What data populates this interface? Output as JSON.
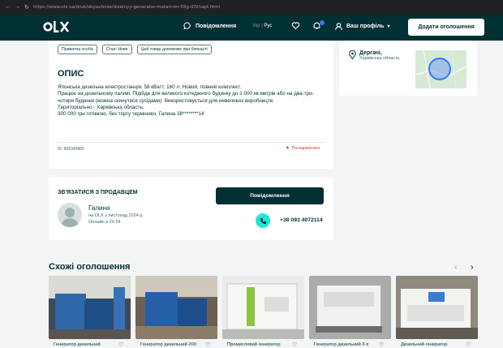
{
  "browser": {
    "url": "https://www.olx.ua/d/uk/obyavlenie/dizelnyy-generator-matari-mr-55g-IDV/uqd.html"
  },
  "header": {
    "messages_label": "Повідомлення",
    "lang_ukr": "Укр",
    "lang_sep": "|",
    "lang_rus": "Рус",
    "profile_label": "Ваш профіль",
    "add_button": "Додати оголошення"
  },
  "tags": [
    "Приватна особа",
    "Стан: Нове",
    "Цей товар допоможе при блекауті"
  ],
  "description": {
    "heading": "ОПИС",
    "lines": [
      "Японська дизельна електростанція, 58 кВатт, 160 л. Новий, повний комплект.",
      "Працює на дизельному паливі. Підійде для великого котеджного будинку до 1 000 кв метрів або на два-три-чотири будинки (можна скинутися сусідами). Використовується для невеликих виробництв.",
      "Територіально - Харківська область.",
      "300 000 грн готівкою, без торгу терміново, Галина 38********14"
    ]
  },
  "ad": {
    "id_text": "ID: 856345865",
    "report_label": "Поскаржитися"
  },
  "location": {
    "city": "Дергачі,",
    "region": "Харківська область"
  },
  "contact": {
    "heading": "ЗВ'ЯЗАТИСЯ З ПРОДАВЦЕМ",
    "message_button": "Повідомлення",
    "seller_name": "Галина",
    "since": "на OLX з листопад 2024 р.",
    "online": "Онлайн в 20:24",
    "phone": "+38 093 4072114"
  },
  "similar": {
    "heading": "Схожі оголошення",
    "items": [
      {
        "title": "Генератор дизельний"
      },
      {
        "title": "Генератор дизельний 200"
      },
      {
        "title": "Промисловий генератор"
      },
      {
        "title": "Генератор дизельний 3-х"
      },
      {
        "title": "Дизельний генератор"
      }
    ]
  },
  "colors": {
    "brand": "#002f34",
    "accent": "#23e5db",
    "report": "#d03830",
    "badge": "#3a77ff"
  }
}
